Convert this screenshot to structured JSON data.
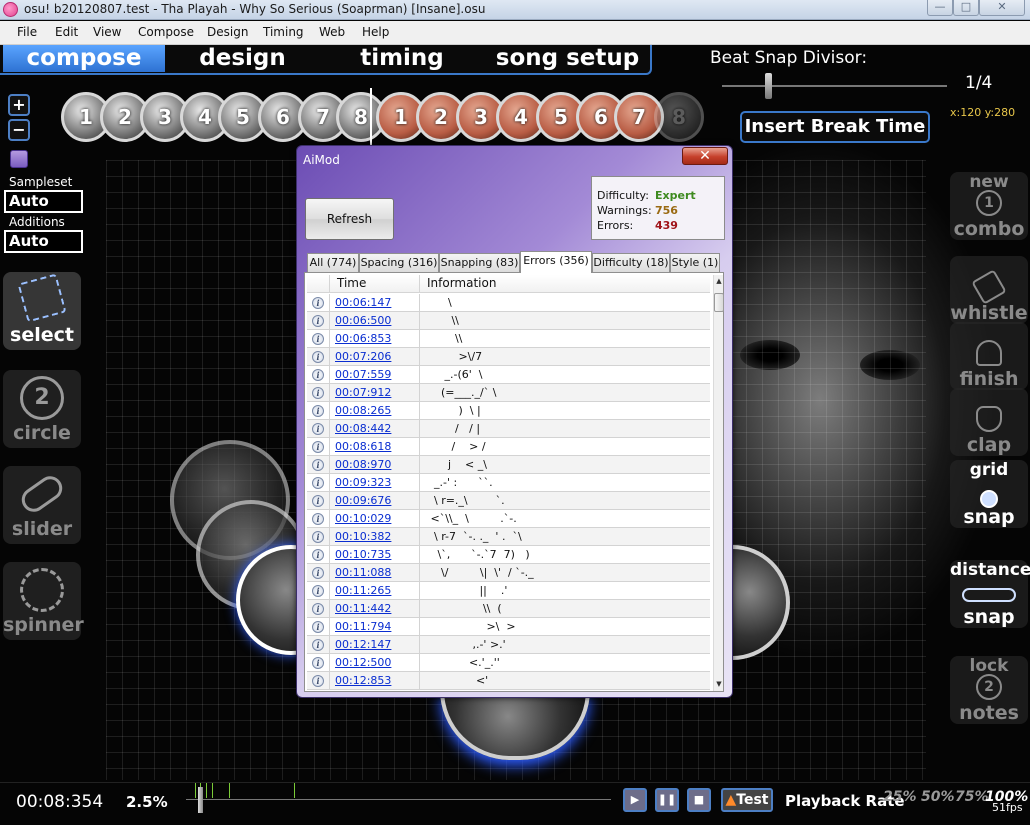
{
  "window": {
    "title": "osu! b20120807.test - Tha Playah - Why So Serious (Soaprman) [Insane].osu",
    "min_label": "—",
    "max_label": "□",
    "close_label": "✕"
  },
  "menu": [
    "File",
    "Edit",
    "View",
    "Compose",
    "Design",
    "Timing",
    "Web",
    "Help"
  ],
  "mode_tabs": [
    {
      "label": "compose",
      "active": true
    },
    {
      "label": "design",
      "active": false
    },
    {
      "label": "timing",
      "active": false
    },
    {
      "label": "song setup",
      "active": false
    }
  ],
  "beat_snap": {
    "label": "Beat Snap Divisor:",
    "value": "1/4"
  },
  "coords_readout": "x:120 y:280",
  "insert_break_label": "Insert Break Time",
  "zoom": {
    "in": "+",
    "out": "−"
  },
  "timeline_numbers": [
    "1",
    "2",
    "3",
    "4",
    "5",
    "6",
    "7",
    "8",
    "1",
    "2",
    "3",
    "4",
    "5",
    "6",
    "7",
    "8"
  ],
  "sampleset": {
    "label": "Sampleset",
    "value": "Auto"
  },
  "additions": {
    "label": "Additions",
    "value": "Auto"
  },
  "tools": [
    {
      "label": "select",
      "icon": "select-icon",
      "active": true
    },
    {
      "label": "circle",
      "icon": "circle-icon",
      "glyph": "2",
      "active": false
    },
    {
      "label": "slider",
      "icon": "slider-icon",
      "active": false
    },
    {
      "label": "spinner",
      "icon": "spinner-icon",
      "active": false
    }
  ],
  "right_tools": [
    {
      "top": "new",
      "bottom": "combo",
      "icon": "new-combo-icon",
      "glyph": "1",
      "on": false
    },
    {
      "top": "",
      "bottom": "whistle",
      "icon": "whistle-icon",
      "glyph": "",
      "on": false
    },
    {
      "top": "",
      "bottom": "finish",
      "icon": "finish-icon",
      "glyph": "",
      "on": false
    },
    {
      "top": "",
      "bottom": "clap",
      "icon": "clap-icon",
      "glyph": "",
      "on": false
    },
    {
      "top": "grid",
      "bottom": "snap",
      "icon": "grid-snap-icon",
      "glyph": "",
      "on": true
    },
    {
      "top": "distance",
      "bottom": "snap",
      "icon": "distance-snap-icon",
      "glyph": "",
      "on": true
    },
    {
      "top": "lock",
      "bottom": "notes",
      "icon": "lock-notes-icon",
      "glyph": "2",
      "on": false
    }
  ],
  "aimod": {
    "title": "AiMod",
    "close_label": "✕",
    "refresh_label": "Refresh",
    "stats": {
      "difficulty_label": "Difficulty:",
      "difficulty_value": "Expert",
      "warnings_label": "Warnings:",
      "warnings_value": "756",
      "errors_label": "Errors:",
      "errors_value": "439"
    },
    "tabs": [
      {
        "label": "All (774)",
        "active": false
      },
      {
        "label": "Spacing (316)",
        "active": false
      },
      {
        "label": "Snapping (83)",
        "active": false
      },
      {
        "label": "Errors (356)",
        "active": true
      },
      {
        "label": "Difficulty (18)",
        "active": false
      },
      {
        "label": "Style (1)",
        "active": false
      }
    ],
    "columns": {
      "time": "Time",
      "info": "Information"
    },
    "rows": [
      {
        "time": "00:06:147",
        "info": "      \\"
      },
      {
        "time": "00:06:500",
        "info": "       \\\\"
      },
      {
        "time": "00:06:853",
        "info": "        \\\\"
      },
      {
        "time": "00:07:206",
        "info": "         >\\/7"
      },
      {
        "time": "00:07:559",
        "info": "     _.-(6'  \\"
      },
      {
        "time": "00:07:912",
        "info": "    (=___._/` \\"
      },
      {
        "time": "00:08:265",
        "info": "         )  \\ |"
      },
      {
        "time": "00:08:442",
        "info": "        /   / |"
      },
      {
        "time": "00:08:618",
        "info": "       /    > /"
      },
      {
        "time": "00:08:970",
        "info": "      j    < _\\"
      },
      {
        "time": "00:09:323",
        "info": "  _.-' :      ``."
      },
      {
        "time": "00:09:676",
        "info": "  \\ r=._\\        `."
      },
      {
        "time": "00:10:029",
        "info": " <`\\\\_  \\         .`-."
      },
      {
        "time": "00:10:382",
        "info": "  \\ r-7  `-. ._  ' .  `\\"
      },
      {
        "time": "00:10:735",
        "info": "   \\`,      `-.`7  7)   )"
      },
      {
        "time": "00:11:088",
        "info": "    \\/         \\|  \\'  / `-._"
      },
      {
        "time": "00:11:265",
        "info": "               ||    .'"
      },
      {
        "time": "00:11:442",
        "info": "                \\\\  ("
      },
      {
        "time": "00:11:794",
        "info": "                 >\\  >"
      },
      {
        "time": "00:12:147",
        "info": "             ,.-' >.'"
      },
      {
        "time": "00:12:500",
        "info": "            <.'_.''"
      },
      {
        "time": "00:12:853",
        "info": "              <'"
      }
    ]
  },
  "bottom": {
    "time": "00:08:354",
    "percent": "2.5%",
    "progress": 0.025,
    "play": "▶",
    "pause": "❚❚",
    "stop": "■",
    "test_label": "Test",
    "playback_label": "Playback Rate",
    "rates": [
      {
        "label": "25%",
        "on": false
      },
      {
        "label": "50%",
        "on": false
      },
      {
        "label": "75%",
        "on": false
      },
      {
        "label": "100%",
        "on": true
      }
    ],
    "fps": "51fps"
  }
}
